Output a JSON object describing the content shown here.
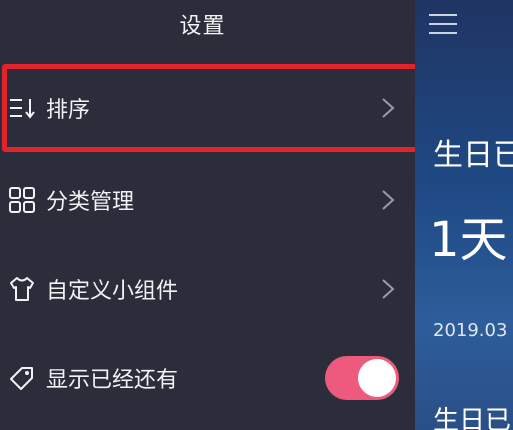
{
  "drawer": {
    "title": "设置",
    "items": [
      {
        "label": "排序",
        "icon": "sort-icon"
      },
      {
        "label": "分类管理",
        "icon": "grid-icon"
      },
      {
        "label": "自定义小组件",
        "icon": "tshirt-icon"
      },
      {
        "label": "显示已经还有",
        "icon": "tag-icon"
      }
    ],
    "toggle_on": true
  },
  "main": {
    "title": "生日已",
    "days": "1天",
    "date": "2019.03",
    "next_title": "生日已"
  },
  "colors": {
    "drawer_bg": "#2b2d3a",
    "highlight": "#e3232b",
    "toggle_on": "#ee5a7d",
    "main_bg": "#1f4a86"
  }
}
